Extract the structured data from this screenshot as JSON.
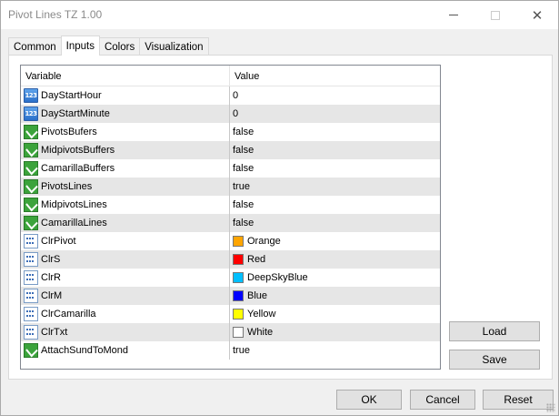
{
  "window": {
    "title": "Pivot Lines TZ 1.00",
    "controls": {
      "minimize": "minimize-icon",
      "maximize": "maximize-icon",
      "close": "close-icon"
    }
  },
  "tabs": [
    {
      "label": "Common",
      "active": false
    },
    {
      "label": "Inputs",
      "active": true
    },
    {
      "label": "Colors",
      "active": false
    },
    {
      "label": "Visualization",
      "active": false
    }
  ],
  "grid": {
    "headers": {
      "variable": "Variable",
      "value": "Value"
    },
    "rows": [
      {
        "icon": "integer-icon",
        "variable": "DayStartHour",
        "value": "0"
      },
      {
        "icon": "integer-icon",
        "variable": "DayStartMinute",
        "value": "0"
      },
      {
        "icon": "boolean-icon",
        "variable": "PivotsBufers",
        "value": "false"
      },
      {
        "icon": "boolean-icon",
        "variable": "MidpivotsBuffers",
        "value": "false"
      },
      {
        "icon": "boolean-icon",
        "variable": "CamarillaBuffers",
        "value": "false"
      },
      {
        "icon": "boolean-icon",
        "variable": "PivotsLines",
        "value": "true"
      },
      {
        "icon": "boolean-icon",
        "variable": "MidpivotsLines",
        "value": "false"
      },
      {
        "icon": "boolean-icon",
        "variable": "CamarillaLines",
        "value": "false"
      },
      {
        "icon": "color-icon",
        "variable": "ClrPivot",
        "value": "Orange",
        "color": "#FFA500"
      },
      {
        "icon": "color-icon",
        "variable": "ClrS",
        "value": "Red",
        "color": "#FF0000"
      },
      {
        "icon": "color-icon",
        "variable": "ClrR",
        "value": "DeepSkyBlue",
        "color": "#00BFFF"
      },
      {
        "icon": "color-icon",
        "variable": "ClrM",
        "value": "Blue",
        "color": "#0000FF"
      },
      {
        "icon": "color-icon",
        "variable": "ClrCamarilla",
        "value": "Yellow",
        "color": "#FFFF00"
      },
      {
        "icon": "color-icon",
        "variable": "ClrTxt",
        "value": "White",
        "color": "#FFFFFF"
      },
      {
        "icon": "boolean-icon",
        "variable": "AttachSundToMond",
        "value": "true"
      }
    ]
  },
  "side_buttons": {
    "load": "Load",
    "save": "Save"
  },
  "footer_buttons": {
    "ok": "OK",
    "cancel": "Cancel",
    "reset": "Reset"
  }
}
